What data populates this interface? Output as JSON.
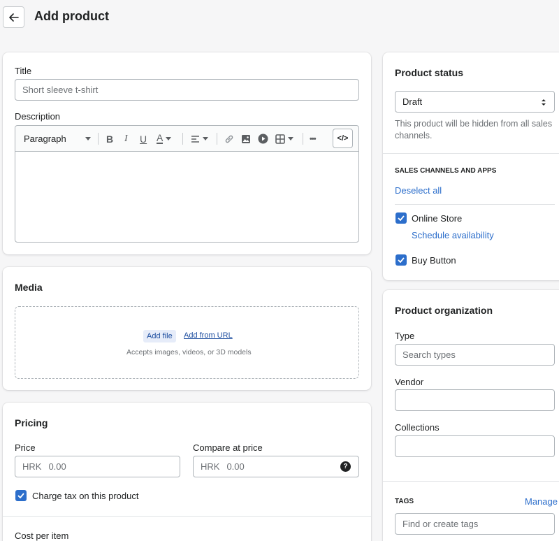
{
  "page": {
    "title": "Add product"
  },
  "title_section": {
    "label": "Title",
    "placeholder": "Short sleeve t-shirt"
  },
  "description": {
    "label": "Description",
    "paragraph_select": "Paragraph",
    "bold": "B",
    "italic": "I",
    "underline": "U",
    "text_color": "A",
    "more": "•••",
    "html_toggle": "</>"
  },
  "media": {
    "heading": "Media",
    "add_file": "Add file",
    "add_url": "Add from URL",
    "hint": "Accepts images, videos, or 3D models"
  },
  "pricing": {
    "heading": "Pricing",
    "price_label": "Price",
    "price_prefix": "HRK",
    "price_value": "0.00",
    "compare_label": "Compare at price",
    "compare_prefix": "HRK",
    "compare_value": "0.00",
    "charge_tax": "Charge tax on this product",
    "charge_tax_checked": true,
    "cost_label": "Cost per item"
  },
  "status": {
    "heading": "Product status",
    "selected": "Draft",
    "help": "This product will be hidden from all sales channels."
  },
  "channels": {
    "heading": "SALES CHANNELS AND APPS",
    "deselect": "Deselect all",
    "items": [
      {
        "label": "Online Store",
        "checked": true,
        "sub_link": "Schedule availability"
      },
      {
        "label": "Buy Button",
        "checked": true
      }
    ]
  },
  "organization": {
    "heading": "Product organization",
    "type_label": "Type",
    "type_placeholder": "Search types",
    "vendor_label": "Vendor",
    "collections_label": "Collections",
    "tags_heading": "TAGS",
    "tags_manage": "Manage",
    "tags_placeholder": "Find or create tags"
  },
  "colors": {
    "accent": "#2c6ecb",
    "background": "#f6f6f7"
  }
}
